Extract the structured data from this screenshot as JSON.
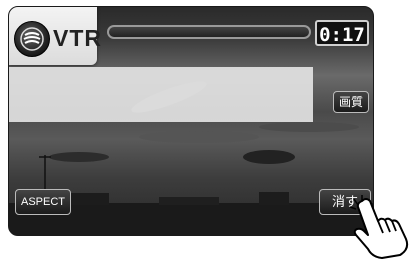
{
  "header": {
    "source_label": "VTR",
    "elapsed_time": "0:17",
    "progress_fraction": 0.0
  },
  "buttons": {
    "picture_quality": "画質",
    "aspect": "ASPECT",
    "delete": "消す"
  },
  "icons": {
    "source": "disc-icon",
    "pointer": "hand-pointer-icon"
  }
}
